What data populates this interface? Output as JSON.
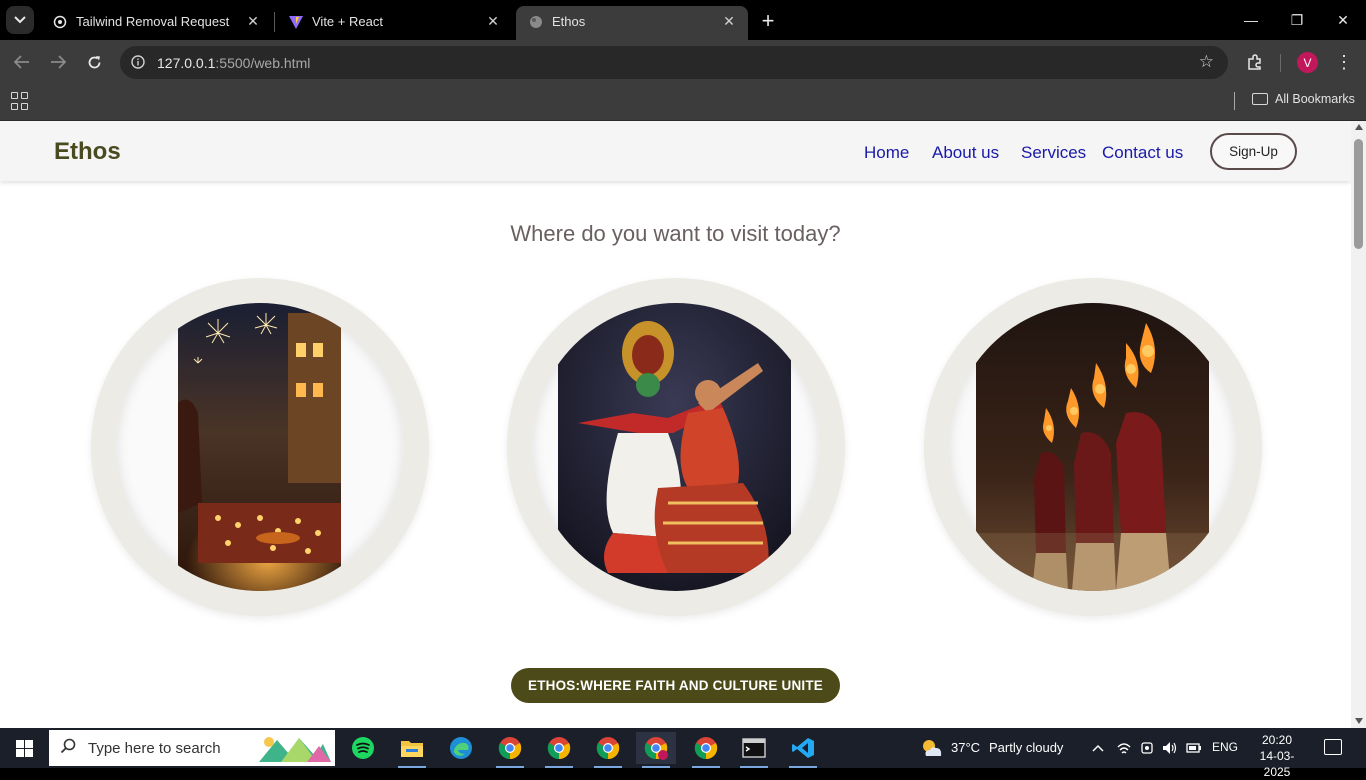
{
  "browser": {
    "tabs": [
      {
        "title": "Tailwind Removal Request",
        "icon": "openai-icon",
        "active": false
      },
      {
        "title": "Vite + React",
        "icon": "vite-icon",
        "active": false
      },
      {
        "title": "Ethos",
        "icon": "globe-icon",
        "active": true
      }
    ],
    "close_glyph": "✕",
    "new_tab_glyph": "+",
    "url_host": "127.0.0.1",
    "url_rest": ":5500/web.html",
    "profile_initial": "V",
    "all_bookmarks": "All Bookmarks",
    "window_controls": {
      "minimize": "—",
      "maximize": "❐",
      "close": "✕"
    }
  },
  "site": {
    "logo": "Ethos",
    "nav": [
      {
        "label": "Home"
      },
      {
        "label": "About us"
      },
      {
        "label": "Services"
      },
      {
        "label": "Contact us"
      }
    ],
    "signup_label": "Sign-Up",
    "headline": "Where do you want to visit today?",
    "destinations": [
      {
        "name": "diwali-festival-photo"
      },
      {
        "name": "classical-dance-photo"
      },
      {
        "name": "ganga-aarti-photo"
      }
    ],
    "tagline": "ETHOS:WHERE FAITH AND CULTURE UNITE",
    "colors": {
      "logo": "#4a4a20",
      "nav_link": "#1a1aa8",
      "tagline_bg": "#4b4a18",
      "circle_ring": "#ecebe6"
    }
  },
  "taskbar": {
    "search_placeholder": "Type here to search",
    "apps": [
      "spotify-icon",
      "file-explorer-icon",
      "edge-icon",
      "chrome-icon",
      "chrome-icon",
      "chrome-icon",
      "chrome-icon",
      "chrome-icon",
      "terminal-icon",
      "vscode-icon"
    ],
    "weather_temp": "37°C",
    "weather_desc": "Partly cloudy",
    "language": "ENG",
    "time": "20:20",
    "date": "14-03-2025"
  }
}
